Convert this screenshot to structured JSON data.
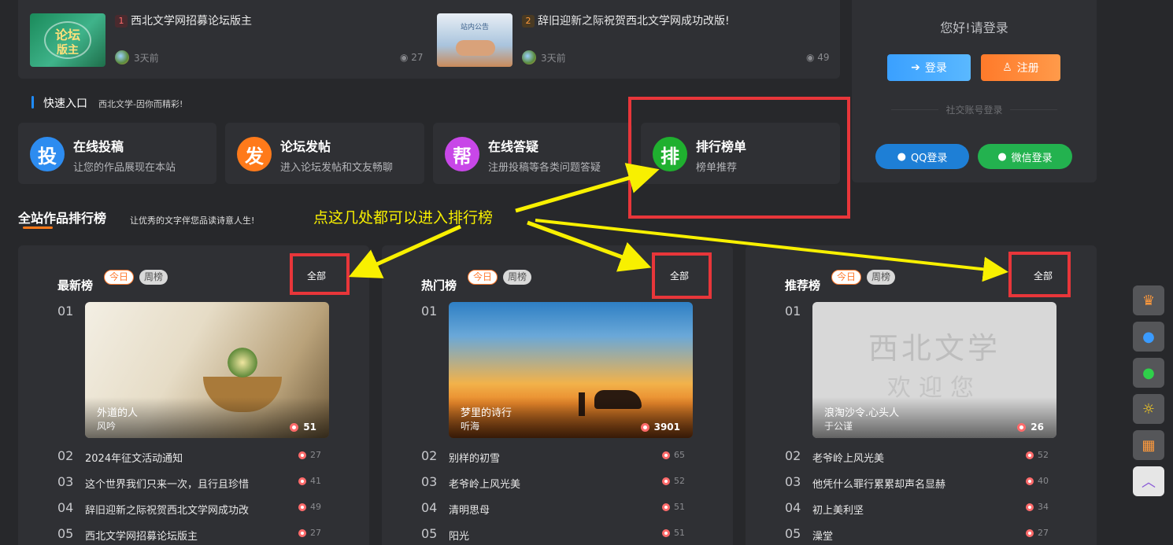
{
  "news": [
    {
      "rank": "1",
      "title": "西北文学网招募论坛版主",
      "time": "3天前",
      "views": "27",
      "thumb_text_1": "论坛",
      "thumb_text_2": "版主"
    },
    {
      "rank": "2",
      "title": "辞旧迎新之际祝贺西北文学网成功改版!",
      "time": "3天前",
      "views": "49",
      "thumb_text_1": "站内公告"
    }
  ],
  "login": {
    "hello": "您好!请登录",
    "login_label": "登录",
    "register_label": "注册",
    "social_label": "社交账号登录",
    "qq_label": "QQ登录",
    "wechat_label": "微信登录"
  },
  "quick": {
    "title": "快速入口",
    "subtitle": "西北文学-因你而精彩!",
    "items": [
      {
        "icon": "投",
        "title": "在线投稿",
        "desc": "让您的作品展现在本站",
        "color": "#2d8cf0"
      },
      {
        "icon": "发",
        "title": "论坛发帖",
        "desc": "进入论坛发帖和文友畅聊",
        "color": "#ff7a1a"
      },
      {
        "icon": "帮",
        "title": "在线答疑",
        "desc": "注册投稿等各类问题答疑",
        "color": "#c847e8"
      },
      {
        "icon": "排",
        "title": "排行榜单",
        "desc": "榜单推荐",
        "color": "#1fb02f"
      }
    ]
  },
  "rank": {
    "title": "全站作品排行榜",
    "subtitle": "让优秀的文字伴您品读诗意人生!",
    "annotation": "点这几处都可以进入排行榜",
    "today_label": "今日",
    "week_label": "周榜",
    "all_label": "全部",
    "columns": [
      {
        "title": "最新榜",
        "top": {
          "num": "01",
          "title": "外道的人",
          "author": "风吟",
          "views": "51"
        },
        "rows": [
          {
            "num": "02",
            "title": "2024年征文活动通知",
            "views": "27"
          },
          {
            "num": "03",
            "title": "这个世界我们只来一次，且行且珍惜",
            "views": "41"
          },
          {
            "num": "04",
            "title": "辞旧迎新之际祝贺西北文学网成功改",
            "views": "49"
          },
          {
            "num": "05",
            "title": "西北文学网招募论坛版主",
            "views": "27"
          }
        ]
      },
      {
        "title": "热门榜",
        "top": {
          "num": "01",
          "title": "梦里的诗行",
          "author": "听海",
          "views": "3901"
        },
        "rows": [
          {
            "num": "02",
            "title": "别样的初雪",
            "views": "65"
          },
          {
            "num": "03",
            "title": "老爷岭上风光美",
            "views": "52"
          },
          {
            "num": "04",
            "title": "清明思母",
            "views": "51"
          },
          {
            "num": "05",
            "title": "阳光",
            "views": "51"
          }
        ]
      },
      {
        "title": "推荐榜",
        "top": {
          "num": "01",
          "title": "浪淘沙令.心头人",
          "author": "于公谨",
          "views": "26",
          "img_line_1": "西北文学",
          "img_line_2": "欢迎您"
        },
        "rows": [
          {
            "num": "02",
            "title": "老爷岭上风光美",
            "views": "52"
          },
          {
            "num": "03",
            "title": "他凭什么罪行累累却声名显赫",
            "views": "40"
          },
          {
            "num": "04",
            "title": "初上美利坚",
            "views": "34"
          },
          {
            "num": "05",
            "title": "澡堂",
            "views": "27"
          }
        ]
      }
    ]
  },
  "side_icons": [
    "crown-icon",
    "chat-bubbles-icon",
    "wechat-icon",
    "sun-theme-icon",
    "qrcode-icon",
    "chevron-up-icon"
  ]
}
